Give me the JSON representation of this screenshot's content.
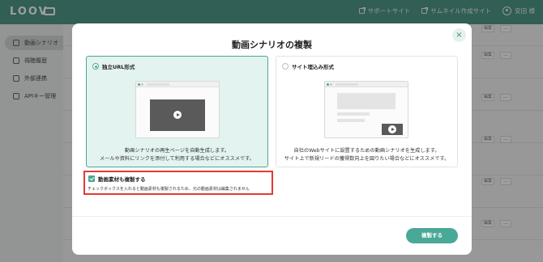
{
  "app": {
    "logo_text": "LOOV",
    "header_links": [
      "サポートサイト",
      "サムネイル作成サイト"
    ],
    "user_name": "安田 様"
  },
  "sidebar": {
    "items": [
      {
        "label": "動画シナリオ",
        "icon": "video-icon"
      },
      {
        "label": "視聴履歴",
        "icon": "user-history-icon"
      },
      {
        "label": "外部連携",
        "icon": "external-link-icon"
      },
      {
        "label": "APIキー管理",
        "icon": "key-icon"
      }
    ]
  },
  "table": {
    "edit_label": "編集",
    "more_label": "…"
  },
  "modal": {
    "title": "動画シナリオの複製",
    "close_label": "×",
    "options": [
      {
        "label": "独立URL形式",
        "selected": true,
        "description_line1": "動画シナリオの再生ページを自動生成します。",
        "description_line2": "メールや資料にリンクを添付して利用する場合などにオススメです。"
      },
      {
        "label": "サイト埋込み形式",
        "selected": false,
        "description_line1": "自社のWebサイトに設置するための動画シナリオを生成します。",
        "description_line2": "サイト上で新規リードの獲得数向上を図りたい場合などにオススメです。"
      }
    ],
    "copy_assets": {
      "label": "動画素材も複製する",
      "checked": true,
      "note": "チェックボックスを入れると動画素材も複製されるため、元の動画素材は編集されません"
    },
    "submit_label": "複製する"
  },
  "colors": {
    "accent": "#4aa896",
    "header": "#3a8a7a",
    "highlight_border": "#e33a33"
  }
}
